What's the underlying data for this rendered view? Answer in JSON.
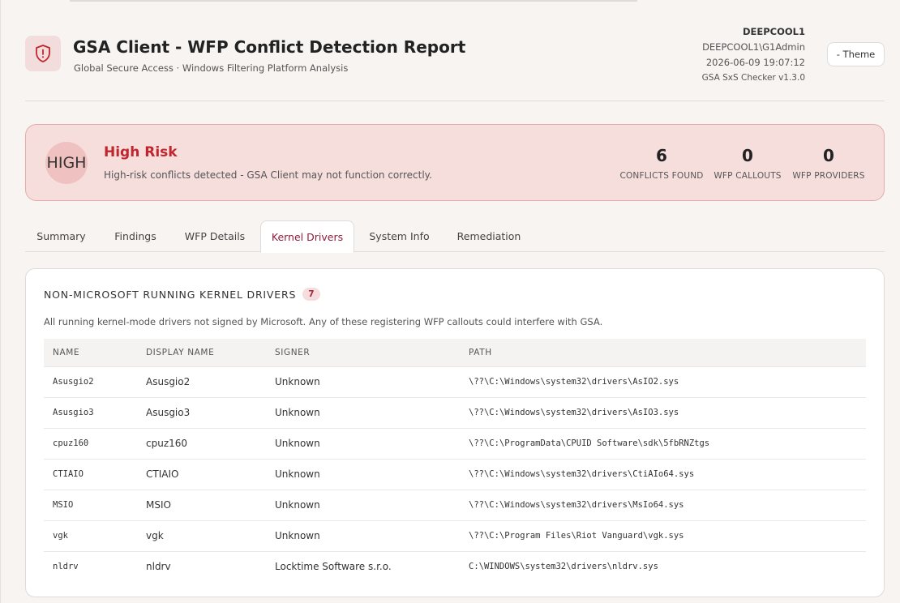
{
  "header": {
    "title": "GSA Client - WFP Conflict Detection Report",
    "subtitle": "Global Secure Access · Windows Filtering Platform Analysis",
    "hostname": "DEEPCOOL1",
    "user": "DEEPCOOL1\\G1Admin",
    "timestamp": "2026-06-09 19:07:12",
    "version": "GSA SxS Checker v1.3.0",
    "theme_button": "- Theme",
    "logo_icon": "shield-alert-icon"
  },
  "risk": {
    "badge": "HIGH",
    "title": "High Risk",
    "description": "High-risk conflicts detected - GSA Client may not function correctly.",
    "accent_color": "#c0262d",
    "stats": [
      {
        "value": "6",
        "label": "CONFLICTS FOUND"
      },
      {
        "value": "0",
        "label": "WFP CALLOUTS"
      },
      {
        "value": "0",
        "label": "WFP PROVIDERS"
      }
    ]
  },
  "tabs": [
    {
      "label": "Summary",
      "active": false
    },
    {
      "label": "Findings",
      "active": false
    },
    {
      "label": "WFP Details",
      "active": false
    },
    {
      "label": "Kernel Drivers",
      "active": true
    },
    {
      "label": "System Info",
      "active": false
    },
    {
      "label": "Remediation",
      "active": false
    }
  ],
  "drivers": {
    "title": "NON-MICROSOFT RUNNING KERNEL DRIVERS",
    "count": "7",
    "description": "All running kernel-mode drivers not signed by Microsoft. Any of these registering WFP callouts could interfere with GSA.",
    "columns": [
      "NAME",
      "DISPLAY NAME",
      "SIGNER",
      "PATH"
    ],
    "rows": [
      {
        "name": "Asusgio2",
        "display": "Asusgio2",
        "signer": "Unknown",
        "path": "\\??\\C:\\Windows\\system32\\drivers\\AsIO2.sys"
      },
      {
        "name": "Asusgio3",
        "display": "Asusgio3",
        "signer": "Unknown",
        "path": "\\??\\C:\\Windows\\system32\\drivers\\AsIO3.sys"
      },
      {
        "name": "cpuz160",
        "display": "cpuz160",
        "signer": "Unknown",
        "path": "\\??\\C:\\ProgramData\\CPUID Software\\sdk\\5fbRNZtgs"
      },
      {
        "name": "CTIAIO",
        "display": "CTIAIO",
        "signer": "Unknown",
        "path": "\\??\\C:\\Windows\\system32\\drivers\\CtiAIo64.sys"
      },
      {
        "name": "MSIO",
        "display": "MSIO",
        "signer": "Unknown",
        "path": "\\??\\C:\\Windows\\system32\\drivers\\MsIo64.sys"
      },
      {
        "name": "vgk",
        "display": "vgk",
        "signer": "Unknown",
        "path": "\\??\\C:\\Program Files\\Riot Vanguard\\vgk.sys"
      },
      {
        "name": "nldrv",
        "display": "nldrv",
        "signer": "Locktime Software s.r.o.",
        "path": "C:\\WINDOWS\\system32\\drivers\\nldrv.sys"
      }
    ]
  }
}
